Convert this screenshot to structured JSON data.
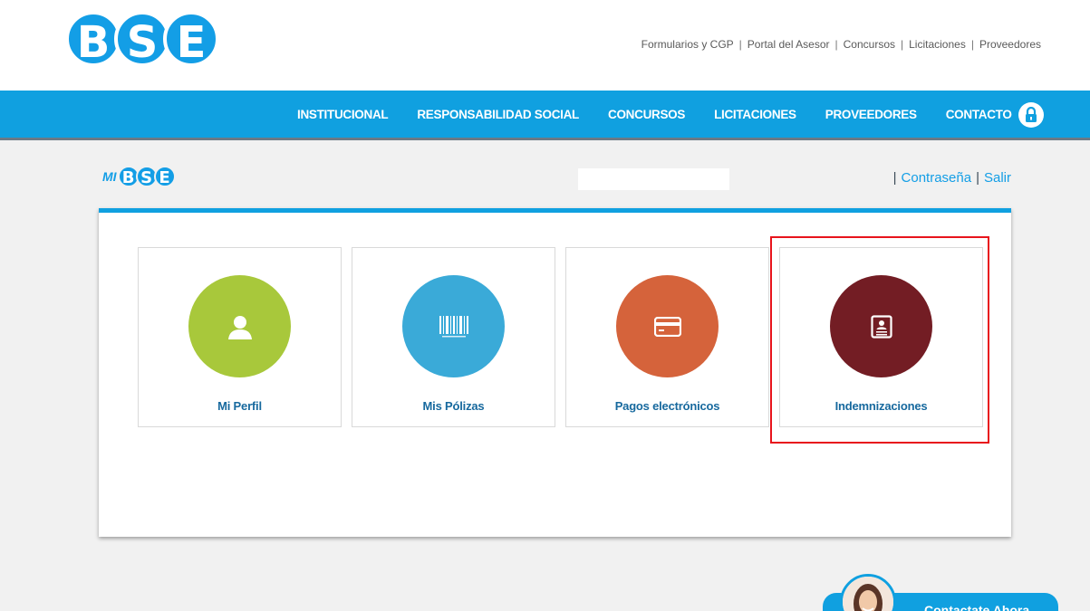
{
  "logo": {
    "letters": [
      "B",
      "S",
      "E"
    ]
  },
  "top_links": [
    "Formularios y CGP",
    "Portal del Asesor",
    "Concursos",
    "Licitaciones",
    "Proveedores"
  ],
  "nav": [
    "INSTITUCIONAL",
    "RESPONSABILIDAD SOCIAL",
    "CONCURSOS",
    "LICITACIONES",
    "PROVEEDORES",
    "CONTACTO"
  ],
  "mibse": {
    "prefix": "MI",
    "letters": [
      "B",
      "S",
      "E"
    ]
  },
  "account": {
    "password": "Contraseña",
    "logout": "Salir",
    "separator": "|"
  },
  "cards": [
    {
      "label": "Mi Perfil",
      "color": "#a8c83b",
      "icon": "user-icon"
    },
    {
      "label": "Mis Pólizas",
      "color": "#3aaad8",
      "icon": "barcode-icon"
    },
    {
      "label": "Pagos electrónicos",
      "color": "#d5633b",
      "icon": "credit-card-icon"
    },
    {
      "label": "Indemnizaciones",
      "color": "#731d24",
      "icon": "id-card-icon"
    }
  ],
  "contact_button": {
    "label": "Contactate Ahora"
  },
  "colors": {
    "brand": "#10a0e0",
    "highlight": "#e8141c",
    "link": "#17699e"
  }
}
